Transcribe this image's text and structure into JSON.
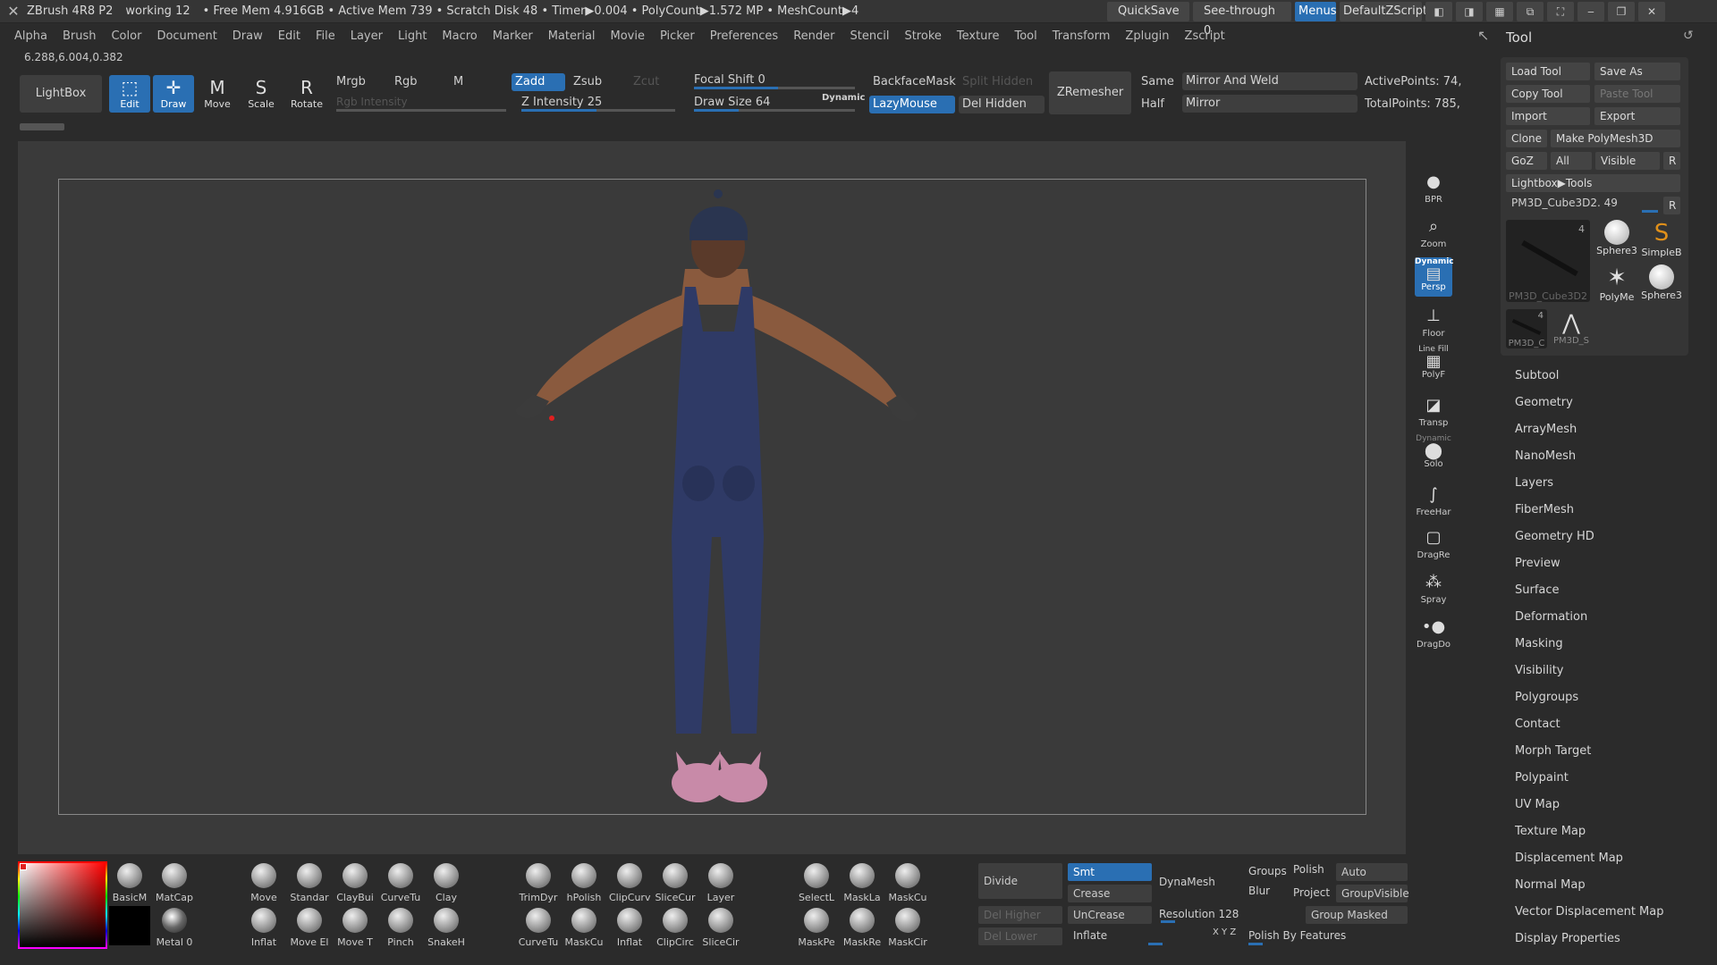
{
  "title_bar": {
    "app": "ZBrush 4R8 P2",
    "doc": "working 12",
    "stats": "• Free Mem 4.916GB • Active Mem 739 • Scratch Disk 48 • Timer▶0.004 • PolyCount▶1.572 MP • MeshCount▶4",
    "quicksave": "QuickSave",
    "see_through": "See-through  0",
    "menus": "Menus",
    "default_zscript": "DefaultZScript"
  },
  "menu": [
    "Alpha",
    "Brush",
    "Color",
    "Document",
    "Draw",
    "Edit",
    "File",
    "Layer",
    "Light",
    "Macro",
    "Marker",
    "Material",
    "Movie",
    "Picker",
    "Preferences",
    "Render",
    "Stencil",
    "Stroke",
    "Texture",
    "Tool",
    "Transform",
    "Zplugin",
    "Zscript"
  ],
  "coords": "6.288,6.004,0.382",
  "toolbar": {
    "lightbox": "LightBox",
    "edit": "Edit",
    "draw": "Draw",
    "move": "Move",
    "scale": "Scale",
    "rotate": "Rotate",
    "mrgb": "Mrgb",
    "rgb": "Rgb",
    "m": "M",
    "zadd": "Zadd",
    "zsub": "Zsub",
    "zcut": "Zcut",
    "rgb_intensity": "Rgb Intensity",
    "z_intensity": "Z Intensity 25",
    "focal_shift": "Focal Shift 0",
    "draw_size": "Draw Size 64",
    "dynamic": "Dynamic",
    "backface_mask": "BackfaceMask",
    "split_hidden": "Split Hidden",
    "lazymouse": "LazyMouse",
    "del_hidden": "Del Hidden",
    "zremesher": "ZRemesher",
    "same": "Same",
    "half": "Half",
    "mirror_weld": "Mirror And Weld",
    "mirror": "Mirror",
    "active_points": "ActivePoints: 74,",
    "total_points": "TotalPoints: 785,"
  },
  "right_icons": {
    "bpr": "BPR",
    "zoom": "Zoom",
    "dynamic": "Dynamic",
    "persp": "Persp",
    "floor": "Floor",
    "line_fill": "Line Fill",
    "polyf": "PolyF",
    "transp": "Transp",
    "dynamic2": "Dynamic",
    "solo": "Solo",
    "freehand": "FreeHar",
    "dragrect": "DragRe",
    "spray": "Spray",
    "dragdot": "DragDo"
  },
  "tool_panel": {
    "title": "Tool",
    "load_tool": "Load Tool",
    "save_as": "Save As",
    "copy_tool": "Copy Tool",
    "paste_tool": "Paste Tool",
    "import": "Import",
    "export": "Export",
    "clone": "Clone",
    "make_polymesh": "Make PolyMesh3D",
    "goz": "GoZ",
    "all": "All",
    "visible": "Visible",
    "r": "R",
    "lightbox_tools": "Lightbox▶Tools",
    "current_tool": "PM3D_Cube3D2. 49",
    "thumbs": [
      {
        "label": "PM3D_Cube3D2",
        "count": "4"
      },
      {
        "label": "Sphere3"
      },
      {
        "label": "SimpleB"
      },
      {
        "label": "PolyMe"
      },
      {
        "label": "Sphere3"
      },
      {
        "label": "PM3D_C",
        "count": "4"
      },
      {
        "label": "PM3D_S"
      }
    ],
    "sections": [
      "Subtool",
      "Geometry",
      "ArrayMesh",
      "NanoMesh",
      "Layers",
      "FiberMesh",
      "Geometry HD",
      "Preview",
      "Surface",
      "Deformation",
      "Masking",
      "Visibility",
      "Polygroups",
      "Contact",
      "Morph Target",
      "Polypaint",
      "UV Map",
      "Texture Map",
      "Displacement Map",
      "Normal Map",
      "Vector Displacement Map",
      "Display Properties"
    ]
  },
  "shelf": {
    "materials": [
      {
        "label": "BasicM"
      },
      {
        "label": "MatCap"
      },
      {
        "label": "Metal 0"
      }
    ],
    "brushes_row1": [
      "Move",
      "Standar",
      "ClayBui",
      "CurveTu",
      "Clay"
    ],
    "brushes_row2": [
      "Inflat",
      "Move El",
      "Move T",
      "Pinch",
      "SnakeH"
    ],
    "brushes2_row1": [
      "TrimDyr",
      "hPolish",
      "ClipCurv",
      "SliceCur",
      "Layer"
    ],
    "brushes2_row2": [
      "CurveTu",
      "MaskCu",
      "Inflat",
      "ClipCirc",
      "SliceCir"
    ],
    "brushes3_row1": [
      "SelectL",
      "MaskLa",
      "MaskCu"
    ],
    "brushes3_row2": [
      "MaskPe",
      "MaskRe",
      "MaskCir"
    ],
    "divide": "Divide",
    "smt": "Smt",
    "crease": "Crease",
    "uncrease": "UnCrease",
    "del_higher": "Del Higher",
    "del_lower": "Del Lower",
    "dynamesh": "DynaMesh",
    "resolution": "Resolution 128",
    "inflate": "Inflate",
    "groups": "Groups",
    "polish": "Polish",
    "blur": "Blur",
    "project": "Project",
    "auto_groups": "Auto Groups",
    "group_visible": "GroupVisible",
    "group_masked": "Group Masked",
    "polish_features": "Polish By Features",
    "xyz": "X Y Z"
  }
}
